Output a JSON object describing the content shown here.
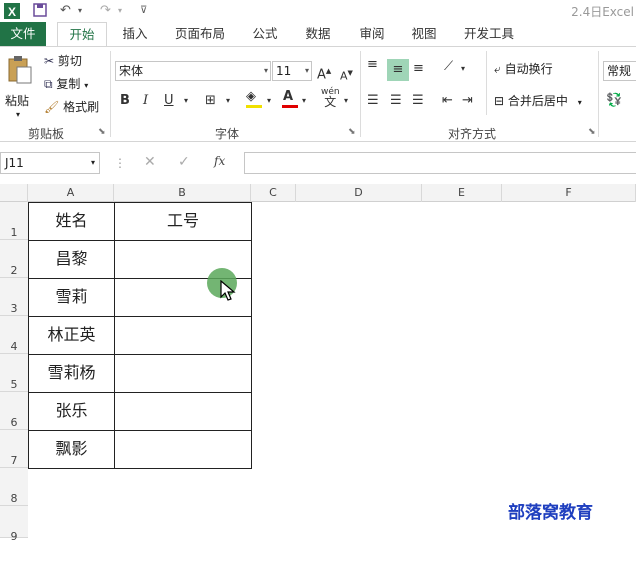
{
  "title_bar": {
    "app_title": "2.4日Excel",
    "quick_access": [
      "excel-logo-icon",
      "save-icon",
      "undo-icon",
      "redo-icon",
      "customize-icon"
    ]
  },
  "tabs": [
    "文件",
    "开始",
    "插入",
    "页面布局",
    "公式",
    "数据",
    "审阅",
    "视图",
    "开发工具"
  ],
  "clipboard": {
    "paste": "粘贴",
    "cut": "剪切",
    "copy": "复制",
    "format_painter": "格式刷",
    "group_label": "剪贴板"
  },
  "font": {
    "name": "宋体",
    "size": "11",
    "group_label": "字体",
    "bold": "B",
    "italic": "I",
    "underline": "U",
    "font_color_letter": "A",
    "wen_label": "wén",
    "wen_char": "文",
    "grow": "A",
    "shrink": "A"
  },
  "alignment": {
    "wrap_text": "自动换行",
    "merge_center": "合并后居中",
    "group_label": "对齐方式"
  },
  "number": {
    "format": "常规"
  },
  "formula_bar": {
    "name_box": "J11",
    "fx": "fx",
    "cancel": "✕",
    "enter": "✓",
    "dots": "⋮"
  },
  "columns": [
    "A",
    "B",
    "C",
    "D",
    "E",
    "F"
  ],
  "rows": [
    "1",
    "2",
    "3",
    "4",
    "5",
    "6",
    "7",
    "8",
    "9"
  ],
  "table": {
    "header": [
      "姓名",
      "工号"
    ],
    "names": [
      "昌黎",
      "雪莉",
      "林正英",
      "雪莉杨",
      "张乐",
      "飘影"
    ]
  },
  "watermark": "部落窝教育",
  "colors": {
    "accent": "#217346",
    "watermark": "#1f3fbf",
    "cursor_highlight": "#5aa85a",
    "font_color_bar": "#e00000",
    "fill_color_bar": "#f0e000"
  }
}
